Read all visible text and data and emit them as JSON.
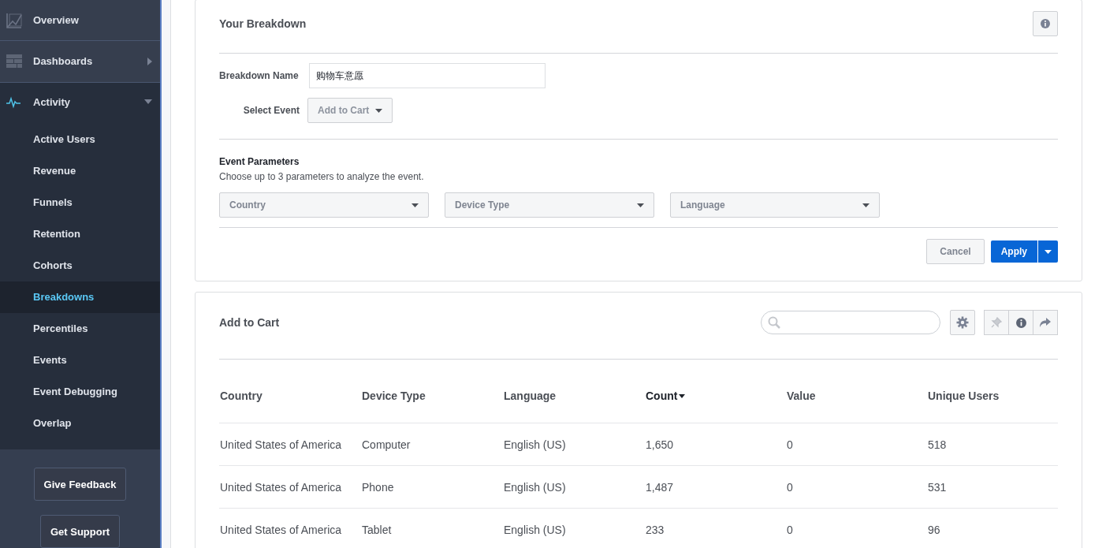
{
  "sidebar": {
    "top_items": [
      {
        "label": "Overview",
        "kind": "overview",
        "expandable": false,
        "expanded": false
      },
      {
        "label": "Dashboards",
        "kind": "dashboards",
        "expandable": true,
        "expanded": false
      },
      {
        "label": "Activity",
        "kind": "activity",
        "expandable": true,
        "expanded": true
      }
    ],
    "sub_items": [
      {
        "label": "Active Users",
        "selected": false
      },
      {
        "label": "Revenue",
        "selected": false
      },
      {
        "label": "Funnels",
        "selected": false
      },
      {
        "label": "Retention",
        "selected": false
      },
      {
        "label": "Cohorts",
        "selected": false
      },
      {
        "label": "Breakdowns",
        "selected": true
      },
      {
        "label": "Percentiles",
        "selected": false
      },
      {
        "label": "Events",
        "selected": false
      },
      {
        "label": "Event Debugging",
        "selected": false
      },
      {
        "label": "Overlap",
        "selected": false
      }
    ],
    "buttons": [
      "Give Feedback",
      "Get Support"
    ]
  },
  "breakdown": {
    "title": "Your Breakdown",
    "name_label": "Breakdown Name",
    "name_value": "购物车意愿",
    "event_label": "Select Event",
    "event_value": "Add to Cart",
    "params_title": "Event Parameters",
    "params_hint": "Choose up to 3 parameters to analyze the event.",
    "params": [
      "Country",
      "Device Type",
      "Language"
    ],
    "cancel": "Cancel",
    "apply": "Apply"
  },
  "results": {
    "title": "Add to Cart",
    "columns": [
      {
        "label": "Country",
        "sorted": false
      },
      {
        "label": "Device Type",
        "sorted": false
      },
      {
        "label": "Language",
        "sorted": false
      },
      {
        "label": "Count",
        "sorted": true
      },
      {
        "label": "Value",
        "sorted": false
      },
      {
        "label": "Unique Users",
        "sorted": false
      }
    ],
    "rows": [
      [
        "United States of America",
        "Computer",
        "English (US)",
        "1,650",
        "0",
        "518"
      ],
      [
        "United States of America",
        "Phone",
        "English (US)",
        "1,487",
        "0",
        "531"
      ],
      [
        "United States of America",
        "Tablet",
        "English (US)",
        "233",
        "0",
        "96"
      ]
    ]
  }
}
